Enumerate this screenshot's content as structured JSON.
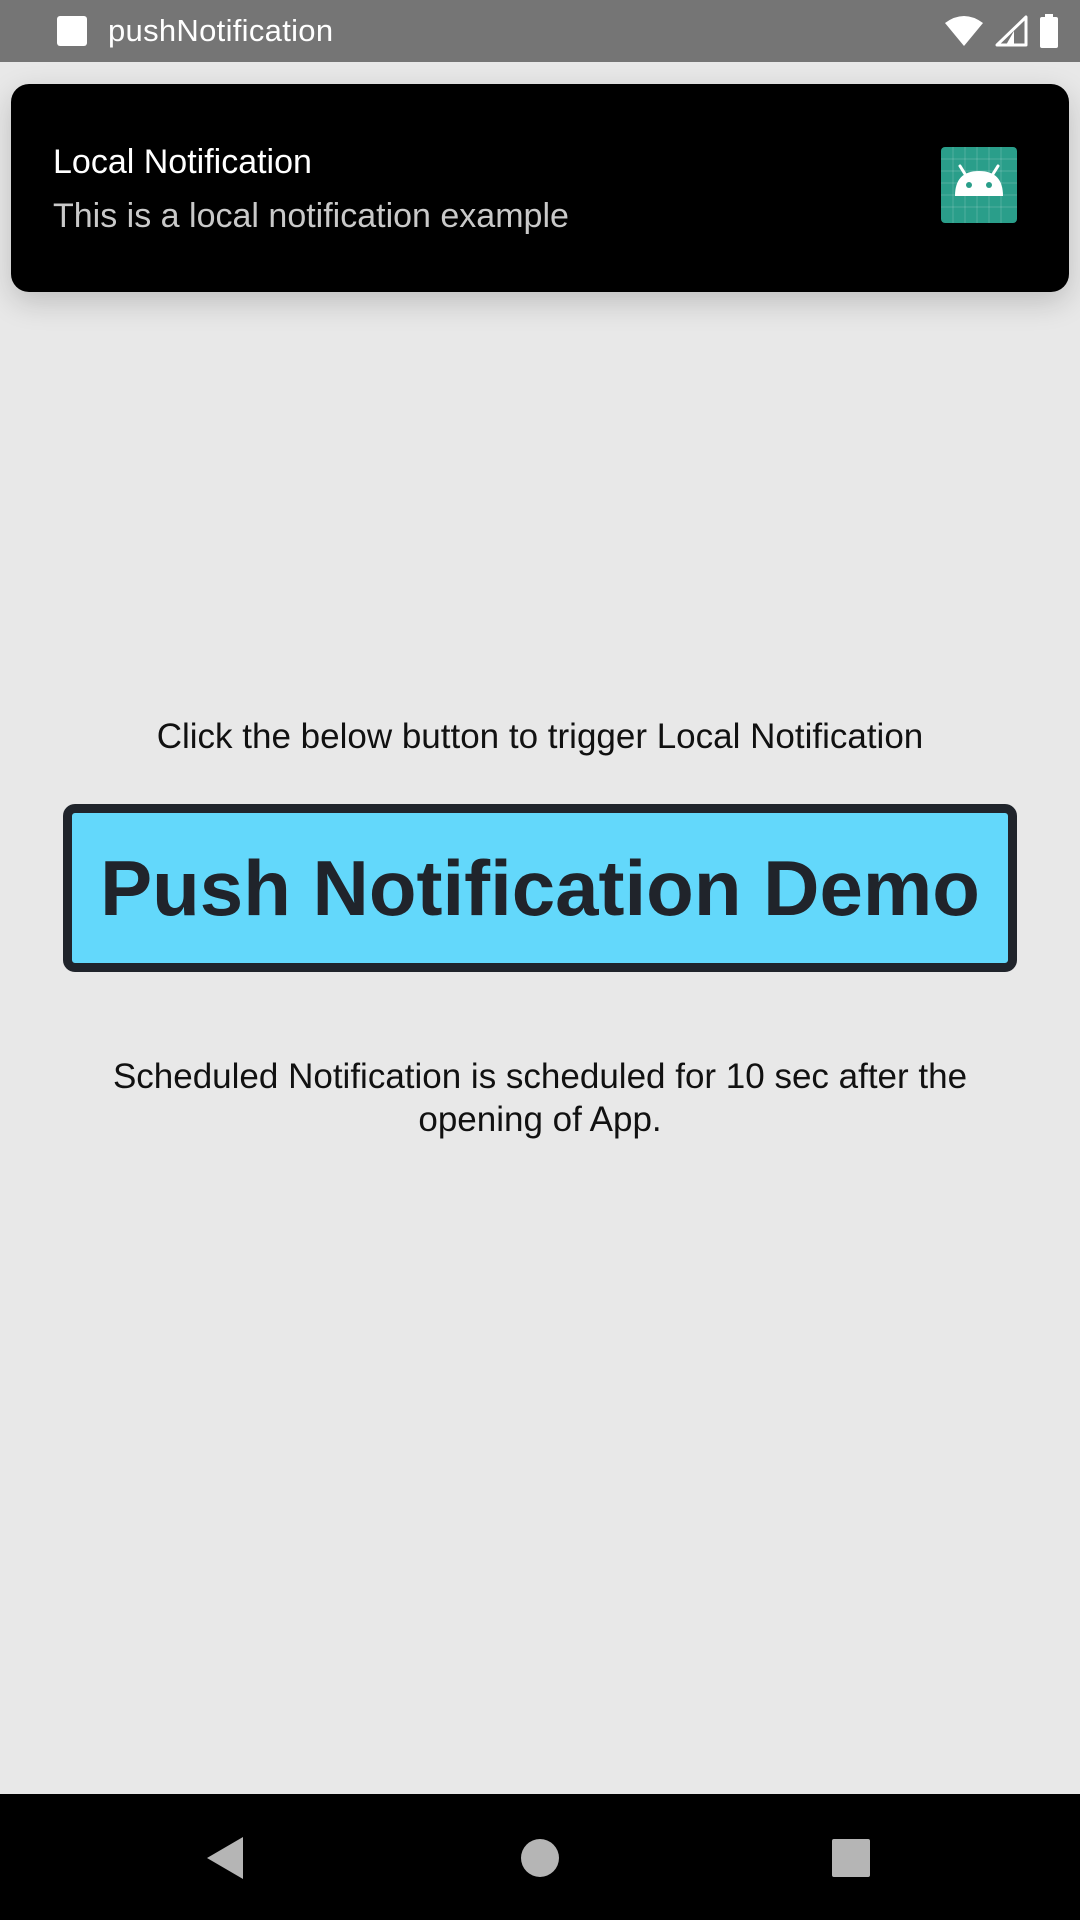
{
  "status_bar": {
    "app_name": "pushNotification",
    "icons": [
      "app-icon",
      "wifi-icon",
      "signal-icon",
      "battery-icon"
    ]
  },
  "notification": {
    "title": "Local Notification",
    "body": "This is a local notification example",
    "icon": "android-icon",
    "icon_color": "#2a9e8a"
  },
  "main": {
    "instruction": "Click the below button to trigger Local Notification",
    "button_label": "Push Notification Demo",
    "button_color": "#63d8fb",
    "schedule_note": "Scheduled Notification is scheduled for 10 sec after the opening of App."
  },
  "nav_bar": {
    "buttons": [
      "back-icon",
      "home-icon",
      "recents-icon"
    ]
  }
}
